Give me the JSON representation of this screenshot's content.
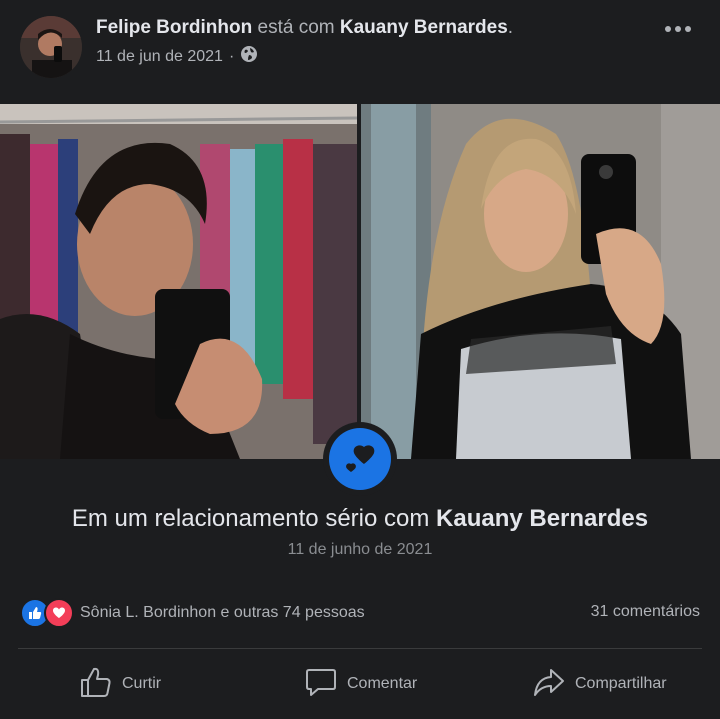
{
  "post": {
    "author": "Felipe Bordinhon",
    "connector": "está com",
    "tagged": "Kauany Bernardes",
    "period": ".",
    "date": "11 de jun de 2021",
    "separator": "·",
    "privacy_icon": "globe-icon",
    "more_icon": "more-icon"
  },
  "relationship": {
    "prefix": "Em um relacionamento sério com",
    "partner": "Kauany Bernardes",
    "date": "11 de junho de 2021",
    "badge_icon": "hearts-icon"
  },
  "reactions": {
    "icons": [
      "like-icon",
      "love-icon"
    ],
    "summary": "Sônia L. Bordinhon e outras 74 pessoas",
    "comments": "31 comentários"
  },
  "actions": [
    {
      "label": "Curtir",
      "icon": "thumbs-up-icon"
    },
    {
      "label": "Comentar",
      "icon": "comment-icon"
    },
    {
      "label": "Compartilhar",
      "icon": "share-icon"
    }
  ],
  "colors": {
    "background": "#1c1d1f",
    "accent": "#1b74e4",
    "love": "#f33e58",
    "text": "#e4e6eb",
    "muted": "#b0b3b8"
  }
}
